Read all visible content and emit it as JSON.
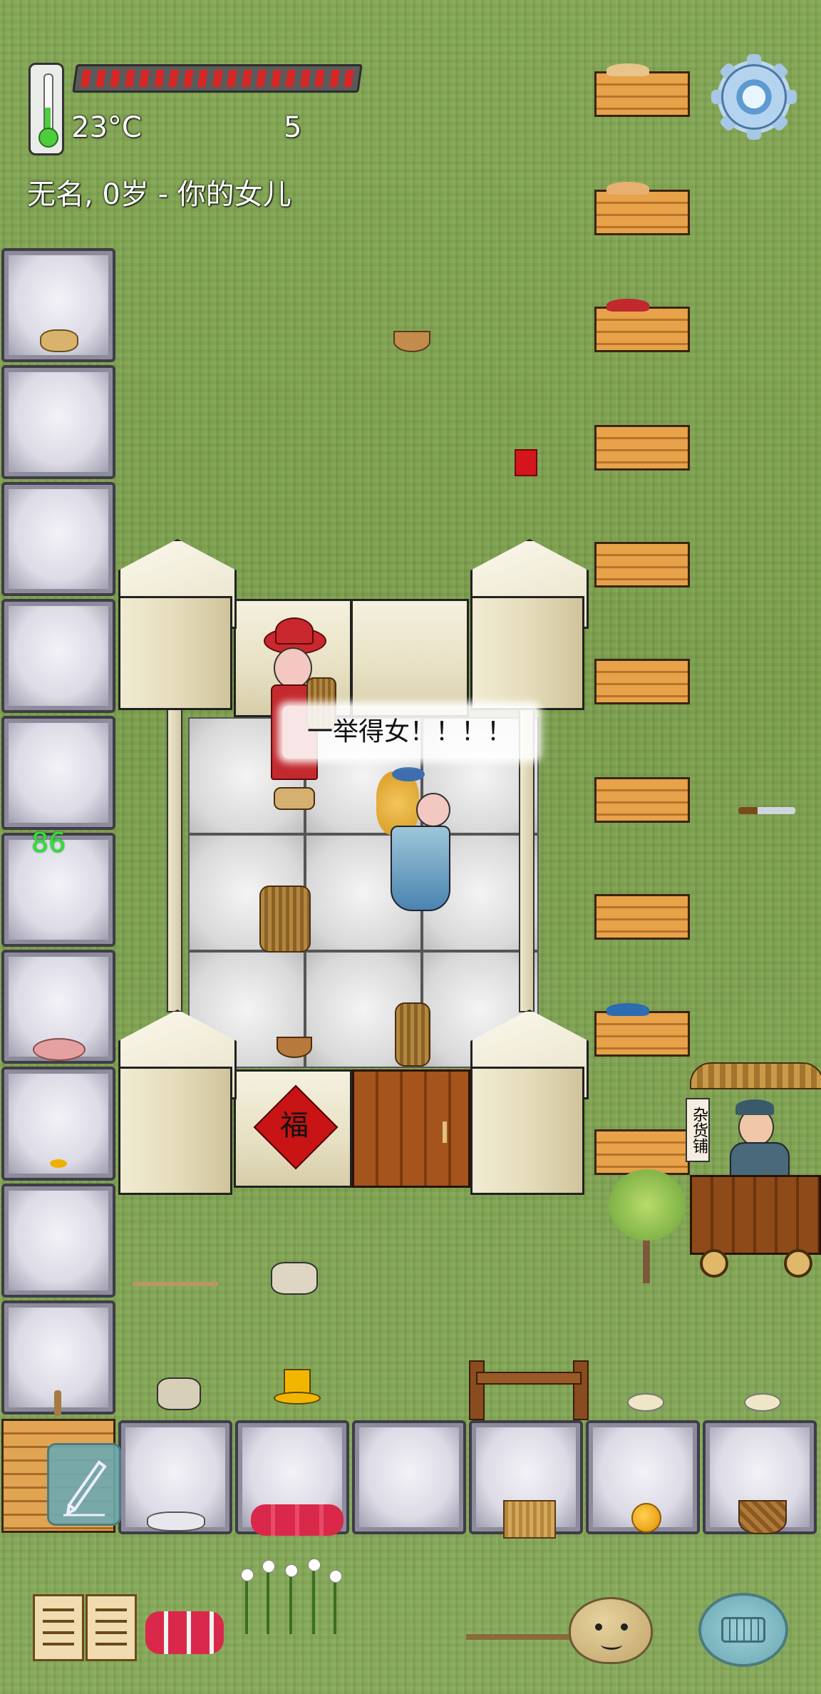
{
  "hud": {
    "temperature": "23°C",
    "food_count": "5",
    "food_pips_total": 19,
    "food_pips_filled": 19,
    "character_label": "无名, 0岁 - 你的女儿"
  },
  "world": {
    "speech_bubble": "一举得女！！！！",
    "coordinate_number": "86",
    "door_charm_text": "福",
    "stall_sign": "杂货铺"
  },
  "colors": {
    "food_pip": "#d72626",
    "thermometer_fill": "#4ccf3a",
    "green_number": "#32e032"
  },
  "controls": {
    "settings": "gear-icon",
    "note": "pencil-icon",
    "recipe_book": "book-icon",
    "keyboard": "keyboard-icon",
    "emote": "potato-face-icon"
  }
}
